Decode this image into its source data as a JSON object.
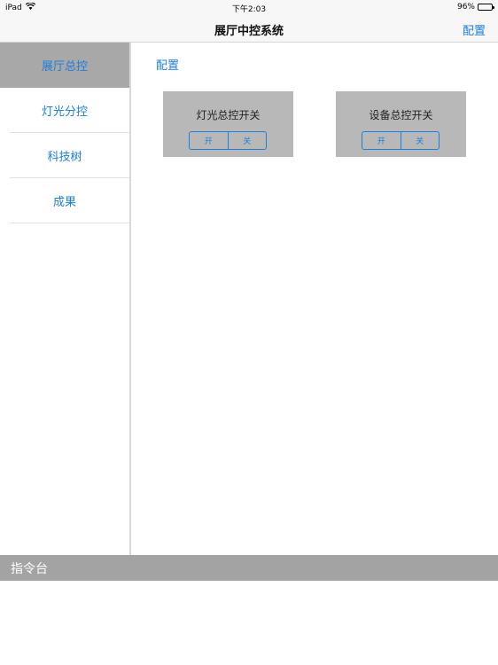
{
  "status_bar": {
    "device": "iPad",
    "time": "下午2:03",
    "battery_percent": "96%",
    "wifi_icon": "wifi-icon",
    "battery_icon": "battery-icon"
  },
  "nav": {
    "title": "展厅中控系统",
    "right_button": "配置"
  },
  "sidebar": {
    "items": [
      {
        "label": "展厅总控",
        "active": true
      },
      {
        "label": "灯光分控",
        "active": false
      },
      {
        "label": "科技树",
        "active": false
      },
      {
        "label": "成果",
        "active": false
      }
    ]
  },
  "main": {
    "config_link": "配置",
    "cards": [
      {
        "title": "灯光总控开关",
        "on_label": "开",
        "off_label": "关"
      },
      {
        "title": "设备总控开关",
        "on_label": "开",
        "off_label": "关"
      }
    ]
  },
  "console": {
    "title": "指令台"
  },
  "colors": {
    "accent": "#1a7fe0",
    "sidebar_active": "#a8a8a8",
    "card_bg": "#b8b8b8",
    "console_bar": "#a3a3a3"
  }
}
